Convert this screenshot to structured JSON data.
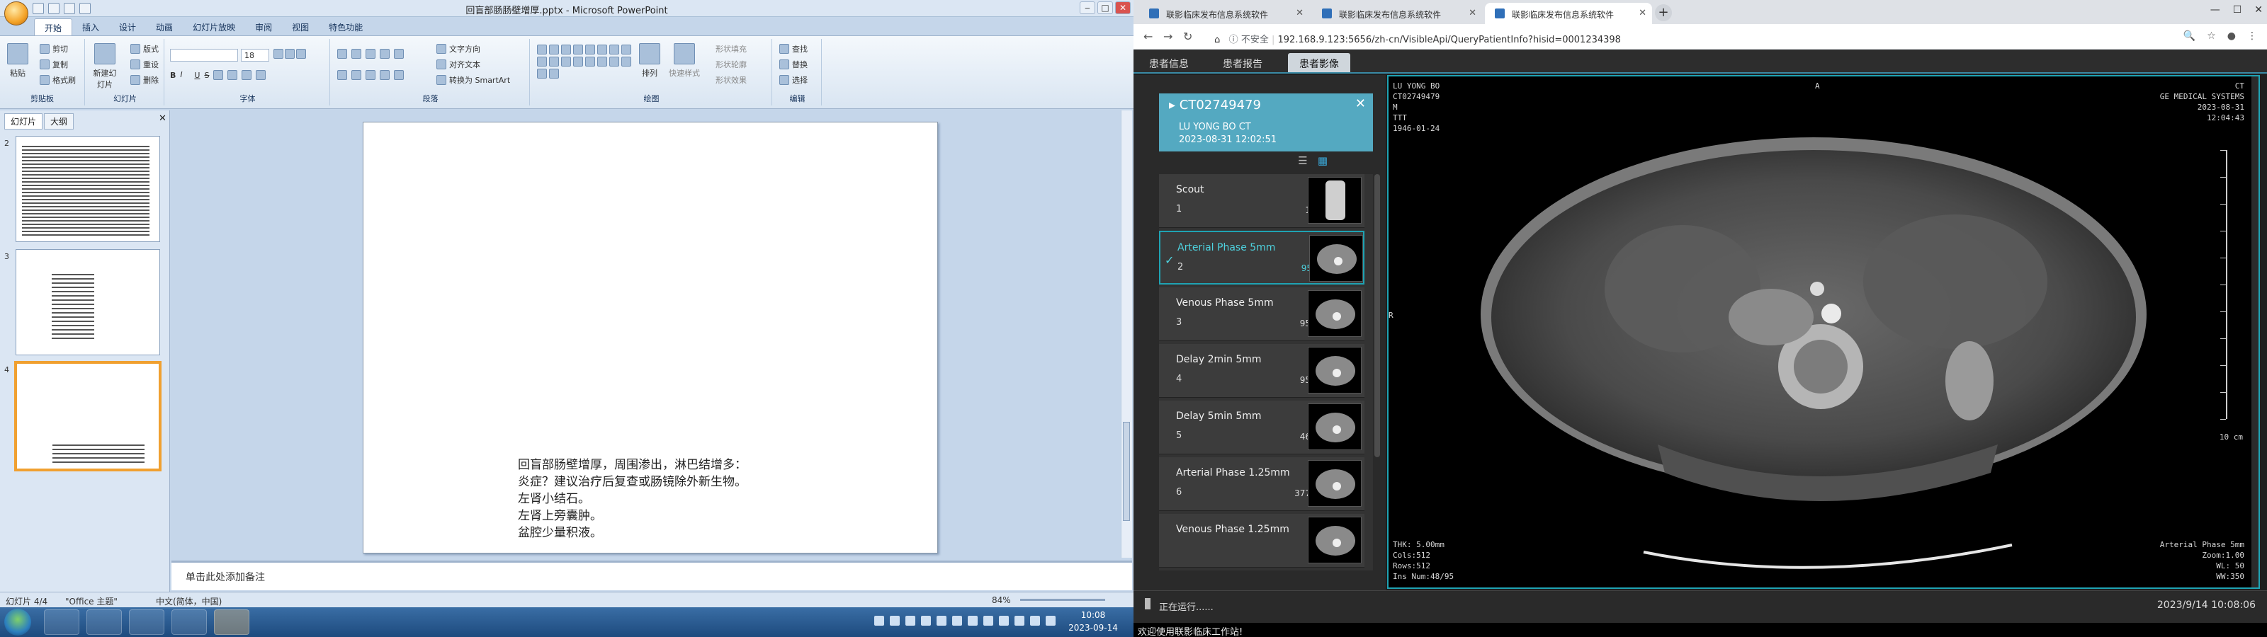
{
  "ppt": {
    "title": "回盲部肠肠壁增厚.pptx - Microsoft PowerPoint",
    "tabs": [
      "开始",
      "插入",
      "设计",
      "动画",
      "幻灯片放映",
      "审阅",
      "视图",
      "特色功能"
    ],
    "ribbon": {
      "clipboard": {
        "label": "剪贴板",
        "paste": "粘贴",
        "cut": "剪切",
        "copy": "复制",
        "format": "格式刷"
      },
      "slides": {
        "label": "幻灯片",
        "new": "新建幻灯片",
        "layout": "版式",
        "reset": "重设",
        "delete": "删除"
      },
      "font": {
        "label": "字体",
        "size": "18"
      },
      "paragraph": {
        "label": "段落",
        "direction": "文字方向",
        "align": "对齐文本",
        "smartart": "转换为 SmartArt"
      },
      "drawing": {
        "label": "绘图",
        "arrange": "排列",
        "quick": "快速样式",
        "fill": "形状填充",
        "outline": "形状轮廓",
        "effects": "形状效果"
      },
      "edit": {
        "label": "编辑",
        "find": "查找",
        "replace": "替换",
        "select": "选择"
      }
    },
    "panel_tabs": [
      "幻灯片",
      "大纲"
    ],
    "thumb_numbers": [
      "2",
      "3",
      "4"
    ],
    "slide_lines": [
      "回盲部肠壁增厚，周围渗出，淋巴结增多：",
      "炎症？建议治疗后复查或肠镜除外新生物。",
      "左肾小结石。",
      "左肾上旁囊肿。",
      "盆腔少量积液。"
    ],
    "notes_placeholder": "单击此处添加备注",
    "status": {
      "slide": "幻灯片 4/4",
      "theme": "\"Office 主题\"",
      "lang": "中文(简体，中国)",
      "zoom": "84%"
    }
  },
  "taskbar": {
    "time": "10:08",
    "date": "2023-09-14"
  },
  "browser": {
    "tabs": [
      "联影临床发布信息系统软件",
      "联影临床发布信息系统软件",
      "联影临床发布信息系统软件"
    ],
    "not_secure": "不安全",
    "url": "192.168.9.123:5656/zh-cn/VisibleApi/QueryPatientInfo?hisid=0001234398"
  },
  "app": {
    "tabs": [
      "患者信息",
      "患者报告",
      "患者影像"
    ],
    "patient": {
      "id": "CT02749479",
      "name": "LU YONG BO CT",
      "datetime": "2023-08-31 12:02:51"
    },
    "series": [
      {
        "name": "Scout",
        "num": "1",
        "count": "1幅"
      },
      {
        "name": "Arterial Phase 5mm",
        "num": "2",
        "count": "95幅"
      },
      {
        "name": "Venous Phase 5mm",
        "num": "3",
        "count": "95幅"
      },
      {
        "name": "Delay 2min 5mm",
        "num": "4",
        "count": "95幅"
      },
      {
        "name": "Delay 5min 5mm",
        "num": "5",
        "count": "46幅"
      },
      {
        "name": "Arterial Phase 1.25mm",
        "num": "6",
        "count": "377幅"
      },
      {
        "name": "Venous Phase 1.25mm",
        "num": "",
        "count": ""
      }
    ],
    "running": "正在运行......",
    "datetime": "2023/9/14  10:08:06",
    "overlay": {
      "tl": [
        "LU YONG BO",
        "CT02749479",
        "M",
        "TTT",
        "1946-01-24"
      ],
      "tc": "A",
      "tr": [
        "CT",
        "GE MEDICAL SYSTEMS",
        "2023-08-31",
        "12:04:43"
      ],
      "left_marker": "R",
      "scale": "10 cm",
      "bl": [
        "THK: 5.00mm",
        "Cols:512",
        "Rows:512",
        "Ins Num:48/95"
      ],
      "br": [
        "Arterial Phase 5mm",
        "Zoom:1.00",
        "WL: 50",
        "WW:350"
      ]
    },
    "welcome": "欢迎使用联影临床工作站!"
  }
}
